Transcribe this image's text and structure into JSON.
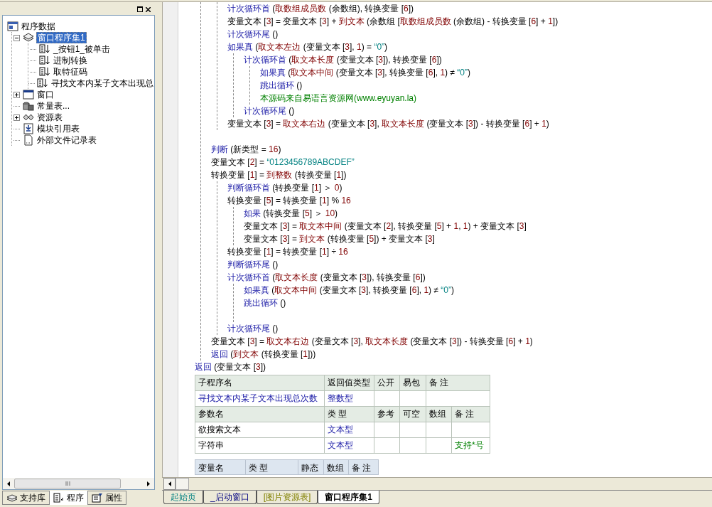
{
  "left_panel": {
    "tree": [
      {
        "kind": "root",
        "label": "程序数据",
        "selected": false,
        "children": [
          {
            "kind": "class",
            "label": "窗口程序集1",
            "selected": true,
            "expanded": true,
            "children": [
              {
                "kind": "method",
                "label": "_按钮1_被单击",
                "selected": false
              },
              {
                "kind": "method",
                "label": "进制转换",
                "selected": false
              },
              {
                "kind": "method",
                "label": "取特征码",
                "selected": false
              },
              {
                "kind": "method",
                "label": "寻找文本内某子文本出现总",
                "selected": false
              }
            ]
          },
          {
            "kind": "window",
            "label": "窗口",
            "selected": false,
            "expanded": false
          },
          {
            "kind": "constants",
            "label": "常量表...",
            "selected": false
          },
          {
            "kind": "resources",
            "label": "资源表",
            "selected": false,
            "expanded": false
          },
          {
            "kind": "modules",
            "label": "模块引用表",
            "selected": false
          },
          {
            "kind": "files",
            "label": "外部文件记录表",
            "selected": false
          }
        ]
      }
    ],
    "tabs": [
      {
        "kind": "library",
        "label": "支持库",
        "selected": false
      },
      {
        "kind": "program",
        "label": "程序",
        "selected": true
      },
      {
        "kind": "properties",
        "label": "属性",
        "selected": false
      }
    ]
  },
  "code": [
    {
      "kind": "group",
      "children": [
        {
          "kind": "group",
          "children": [
            {
              "kind": "line",
              "tokens": [
                {
                  "kind": "kw",
                  "text": "计次循环首"
                },
                {
                  "kind": "txt",
                  "text": " ("
                },
                {
                  "kind": "fn",
                  "text": "取数组成员数"
                },
                {
                  "kind": "txt",
                  "text": " (余数组), 转换变量 ["
                },
                {
                  "kind": "num",
                  "text": "6"
                },
                {
                  "kind": "txt",
                  "text": "])"
                }
              ]
            },
            {
              "kind": "line",
              "tokens": [
                {
                  "kind": "txt",
                  "text": "变量文本 ["
                },
                {
                  "kind": "num",
                  "text": "3"
                },
                {
                  "kind": "txt",
                  "text": "] = 变量文本 ["
                },
                {
                  "kind": "num",
                  "text": "3"
                },
                {
                  "kind": "txt",
                  "text": "] + "
                },
                {
                  "kind": "fn",
                  "text": "到文本"
                },
                {
                  "kind": "txt",
                  "text": " (余数组 ["
                },
                {
                  "kind": "fn",
                  "text": "取数组成员数"
                },
                {
                  "kind": "txt",
                  "text": " (余数组) - 转换变量 ["
                },
                {
                  "kind": "num",
                  "text": "6"
                },
                {
                  "kind": "txt",
                  "text": "] + "
                },
                {
                  "kind": "num",
                  "text": "1"
                },
                {
                  "kind": "txt",
                  "text": "])"
                }
              ]
            },
            {
              "kind": "line",
              "tokens": [
                {
                  "kind": "kw",
                  "text": "计次循环尾"
                },
                {
                  "kind": "txt",
                  "text": " ()"
                }
              ]
            },
            {
              "kind": "line",
              "tokens": [
                {
                  "kind": "kw",
                  "text": "如果真"
                },
                {
                  "kind": "txt",
                  "text": " ("
                },
                {
                  "kind": "fn",
                  "text": "取文本左边"
                },
                {
                  "kind": "txt",
                  "text": " (变量文本 ["
                },
                {
                  "kind": "num",
                  "text": "3"
                },
                {
                  "kind": "txt",
                  "text": "], "
                },
                {
                  "kind": "num",
                  "text": "1"
                },
                {
                  "kind": "txt",
                  "text": ") = "
                },
                {
                  "kind": "str",
                  "text": "“0”"
                },
                {
                  "kind": "txt",
                  "text": ")"
                }
              ],
              "children": [
                {
                  "kind": "line",
                  "tokens": [
                    {
                      "kind": "kw",
                      "text": "计次循环首"
                    },
                    {
                      "kind": "txt",
                      "text": " ("
                    },
                    {
                      "kind": "fn",
                      "text": "取文本长度"
                    },
                    {
                      "kind": "txt",
                      "text": " (变量文本 ["
                    },
                    {
                      "kind": "num",
                      "text": "3"
                    },
                    {
                      "kind": "txt",
                      "text": "]), 转换变量 ["
                    },
                    {
                      "kind": "num",
                      "text": "6"
                    },
                    {
                      "kind": "txt",
                      "text": "])"
                    }
                  ],
                  "children": [
                    {
                      "kind": "line",
                      "tokens": [
                        {
                          "kind": "kw",
                          "text": "如果真"
                        },
                        {
                          "kind": "txt",
                          "text": " ("
                        },
                        {
                          "kind": "fn",
                          "text": "取文本中间"
                        },
                        {
                          "kind": "txt",
                          "text": " (变量文本 ["
                        },
                        {
                          "kind": "num",
                          "text": "3"
                        },
                        {
                          "kind": "txt",
                          "text": "], 转换变量 ["
                        },
                        {
                          "kind": "num",
                          "text": "6"
                        },
                        {
                          "kind": "txt",
                          "text": "], "
                        },
                        {
                          "kind": "num",
                          "text": "1"
                        },
                        {
                          "kind": "txt",
                          "text": ") ≠ "
                        },
                        {
                          "kind": "str",
                          "text": "“0”"
                        },
                        {
                          "kind": "txt",
                          "text": ")"
                        }
                      ]
                    },
                    {
                      "kind": "line",
                      "tokens": [
                        {
                          "kind": "kw",
                          "text": "跳出循环"
                        },
                        {
                          "kind": "txt",
                          "text": " ()"
                        }
                      ]
                    },
                    {
                      "kind": "line",
                      "tokens": [
                        {
                          "kind": "cmt",
                          "text": "本源码来自易语言资源网(www.eyuyan.la)"
                        }
                      ]
                    }
                  ]
                },
                {
                  "kind": "line",
                  "tokens": [
                    {
                      "kind": "kw",
                      "text": "计次循环尾"
                    },
                    {
                      "kind": "txt",
                      "text": " ()"
                    }
                  ]
                }
              ]
            },
            {
              "kind": "line",
              "tokens": [
                {
                  "kind": "txt",
                  "text": "变量文本 ["
                },
                {
                  "kind": "num",
                  "text": "3"
                },
                {
                  "kind": "txt",
                  "text": "] = "
                },
                {
                  "kind": "fn",
                  "text": "取文本右边"
                },
                {
                  "kind": "txt",
                  "text": " (变量文本 ["
                },
                {
                  "kind": "num",
                  "text": "3"
                },
                {
                  "kind": "txt",
                  "text": "], "
                },
                {
                  "kind": "fn",
                  "text": "取文本长度"
                },
                {
                  "kind": "txt",
                  "text": " (变量文本 ["
                },
                {
                  "kind": "num",
                  "text": "3"
                },
                {
                  "kind": "txt",
                  "text": "]) - 转换变量 ["
                },
                {
                  "kind": "num",
                  "text": "6"
                },
                {
                  "kind": "txt",
                  "text": "] + "
                },
                {
                  "kind": "num",
                  "text": "1"
                },
                {
                  "kind": "txt",
                  "text": ")"
                }
              ]
            }
          ]
        },
        {
          "kind": "blank"
        },
        {
          "kind": "line",
          "tokens": [
            {
              "kind": "kw",
              "text": "判断"
            },
            {
              "kind": "txt",
              "text": " (新类型 = "
            },
            {
              "kind": "num",
              "text": "16"
            },
            {
              "kind": "txt",
              "text": ")"
            }
          ]
        },
        {
          "kind": "line",
          "tokens": [
            {
              "kind": "txt",
              "text": "变量文本 ["
            },
            {
              "kind": "num",
              "text": "2"
            },
            {
              "kind": "txt",
              "text": "] = "
            },
            {
              "kind": "str",
              "text": "“0123456789ABCDEF”"
            }
          ]
        },
        {
          "kind": "line",
          "tokens": [
            {
              "kind": "txt",
              "text": "转换变量 ["
            },
            {
              "kind": "num",
              "text": "1"
            },
            {
              "kind": "txt",
              "text": "] = "
            },
            {
              "kind": "fn",
              "text": "到整数"
            },
            {
              "kind": "txt",
              "text": " (转换变量 ["
            },
            {
              "kind": "num",
              "text": "1"
            },
            {
              "kind": "txt",
              "text": "])"
            }
          ]
        },
        {
          "kind": "group",
          "children": [
            {
              "kind": "line",
              "tokens": [
                {
                  "kind": "kw",
                  "text": "判断循环首"
                },
                {
                  "kind": "txt",
                  "text": " (转换变量 ["
                },
                {
                  "kind": "num",
                  "text": "1"
                },
                {
                  "kind": "txt",
                  "text": "] ＞ "
                },
                {
                  "kind": "num",
                  "text": "0"
                },
                {
                  "kind": "txt",
                  "text": ")"
                }
              ]
            },
            {
              "kind": "line",
              "tokens": [
                {
                  "kind": "txt",
                  "text": "转换变量 ["
                },
                {
                  "kind": "num",
                  "text": "5"
                },
                {
                  "kind": "txt",
                  "text": "] = 转换变量 ["
                },
                {
                  "kind": "num",
                  "text": "1"
                },
                {
                  "kind": "txt",
                  "text": "] % "
                },
                {
                  "kind": "num",
                  "text": "16"
                }
              ]
            },
            {
              "kind": "group",
              "children": [
                {
                  "kind": "line",
                  "tokens": [
                    {
                      "kind": "kw",
                      "text": "如果"
                    },
                    {
                      "kind": "txt",
                      "text": " (转换变量 ["
                    },
                    {
                      "kind": "num",
                      "text": "5"
                    },
                    {
                      "kind": "txt",
                      "text": "] ＞ "
                    },
                    {
                      "kind": "num",
                      "text": "10"
                    },
                    {
                      "kind": "txt",
                      "text": ")"
                    }
                  ]
                },
                {
                  "kind": "line",
                  "tokens": [
                    {
                      "kind": "txt",
                      "text": "变量文本 ["
                    },
                    {
                      "kind": "num",
                      "text": "3"
                    },
                    {
                      "kind": "txt",
                      "text": "] = "
                    },
                    {
                      "kind": "fn",
                      "text": "取文本中间"
                    },
                    {
                      "kind": "txt",
                      "text": " (变量文本 ["
                    },
                    {
                      "kind": "num",
                      "text": "2"
                    },
                    {
                      "kind": "txt",
                      "text": "], 转换变量 ["
                    },
                    {
                      "kind": "num",
                      "text": "5"
                    },
                    {
                      "kind": "txt",
                      "text": "] + "
                    },
                    {
                      "kind": "num",
                      "text": "1"
                    },
                    {
                      "kind": "txt",
                      "text": ", "
                    },
                    {
                      "kind": "num",
                      "text": "1"
                    },
                    {
                      "kind": "txt",
                      "text": ") + 变量文本 ["
                    },
                    {
                      "kind": "num",
                      "text": "3"
                    },
                    {
                      "kind": "txt",
                      "text": "]"
                    }
                  ]
                },
                {
                  "kind": "line",
                  "tokens": [
                    {
                      "kind": "txt",
                      "text": "变量文本 ["
                    },
                    {
                      "kind": "num",
                      "text": "3"
                    },
                    {
                      "kind": "txt",
                      "text": "] = "
                    },
                    {
                      "kind": "fn",
                      "text": "到文本"
                    },
                    {
                      "kind": "txt",
                      "text": " (转换变量 ["
                    },
                    {
                      "kind": "num",
                      "text": "5"
                    },
                    {
                      "kind": "txt",
                      "text": "]) + 变量文本 ["
                    },
                    {
                      "kind": "num",
                      "text": "3"
                    },
                    {
                      "kind": "txt",
                      "text": "]"
                    }
                  ]
                }
              ]
            },
            {
              "kind": "line",
              "tokens": [
                {
                  "kind": "txt",
                  "text": "转换变量 ["
                },
                {
                  "kind": "num",
                  "text": "1"
                },
                {
                  "kind": "txt",
                  "text": "] = 转换变量 ["
                },
                {
                  "kind": "num",
                  "text": "1"
                },
                {
                  "kind": "txt",
                  "text": "] ÷ "
                },
                {
                  "kind": "num",
                  "text": "16"
                }
              ]
            },
            {
              "kind": "line",
              "tokens": [
                {
                  "kind": "kw",
                  "text": "判断循环尾"
                },
                {
                  "kind": "txt",
                  "text": " ()"
                }
              ]
            },
            {
              "kind": "line",
              "tokens": [
                {
                  "kind": "kw",
                  "text": "计次循环首"
                },
                {
                  "kind": "txt",
                  "text": " ("
                },
                {
                  "kind": "fn",
                  "text": "取文本长度"
                },
                {
                  "kind": "txt",
                  "text": " (变量文本 ["
                },
                {
                  "kind": "num",
                  "text": "3"
                },
                {
                  "kind": "txt",
                  "text": "]), 转换变量 ["
                },
                {
                  "kind": "num",
                  "text": "6"
                },
                {
                  "kind": "txt",
                  "text": "])"
                }
              ],
              "children": [
                {
                  "kind": "line",
                  "tokens": [
                    {
                      "kind": "kw",
                      "text": "如果真"
                    },
                    {
                      "kind": "txt",
                      "text": " ("
                    },
                    {
                      "kind": "fn",
                      "text": "取文本中间"
                    },
                    {
                      "kind": "txt",
                      "text": " (变量文本 ["
                    },
                    {
                      "kind": "num",
                      "text": "3"
                    },
                    {
                      "kind": "txt",
                      "text": "], 转换变量 ["
                    },
                    {
                      "kind": "num",
                      "text": "6"
                    },
                    {
                      "kind": "txt",
                      "text": "], "
                    },
                    {
                      "kind": "num",
                      "text": "1"
                    },
                    {
                      "kind": "txt",
                      "text": ") ≠ "
                    },
                    {
                      "kind": "str",
                      "text": "“0”"
                    },
                    {
                      "kind": "txt",
                      "text": ")"
                    }
                  ]
                },
                {
                  "kind": "line",
                  "tokens": [
                    {
                      "kind": "kw",
                      "text": "跳出循环"
                    },
                    {
                      "kind": "txt",
                      "text": " ()"
                    }
                  ]
                },
                {
                  "kind": "blank"
                }
              ]
            },
            {
              "kind": "line",
              "tokens": [
                {
                  "kind": "kw",
                  "text": "计次循环尾"
                },
                {
                  "kind": "txt",
                  "text": " ()"
                }
              ]
            }
          ]
        },
        {
          "kind": "line",
          "tokens": [
            {
              "kind": "txt",
              "text": "变量文本 ["
            },
            {
              "kind": "num",
              "text": "3"
            },
            {
              "kind": "txt",
              "text": "] = "
            },
            {
              "kind": "fn",
              "text": "取文本右边"
            },
            {
              "kind": "txt",
              "text": " (变量文本 ["
            },
            {
              "kind": "num",
              "text": "3"
            },
            {
              "kind": "txt",
              "text": "], "
            },
            {
              "kind": "fn",
              "text": "取文本长度"
            },
            {
              "kind": "txt",
              "text": " (变量文本 ["
            },
            {
              "kind": "num",
              "text": "3"
            },
            {
              "kind": "txt",
              "text": "]) - 转换变量 ["
            },
            {
              "kind": "num",
              "text": "6"
            },
            {
              "kind": "txt",
              "text": "] + "
            },
            {
              "kind": "num",
              "text": "1"
            },
            {
              "kind": "txt",
              "text": ")"
            }
          ]
        },
        {
          "kind": "line",
          "tokens": [
            {
              "kind": "kw",
              "text": "返回"
            },
            {
              "kind": "txt",
              "text": " ("
            },
            {
              "kind": "fn",
              "text": "到文本"
            },
            {
              "kind": "txt",
              "text": " (转换变量 ["
            },
            {
              "kind": "num",
              "text": "1"
            },
            {
              "kind": "txt",
              "text": "]))"
            }
          ]
        }
      ]
    },
    {
      "kind": "line",
      "tokens": [
        {
          "kind": "kw",
          "text": "返回"
        },
        {
          "kind": "txt",
          "text": " (变量文本 ["
        },
        {
          "kind": "num",
          "text": "3"
        },
        {
          "kind": "txt",
          "text": "])"
        }
      ]
    }
  ],
  "subroutine_table": {
    "columns": [
      "子程序名",
      "返回值类型",
      "公开",
      "易包",
      "备 注"
    ],
    "row": [
      "寻找文本内某子文本出现总次数",
      "整数型"
    ]
  },
  "params_table": {
    "columns": [
      "参数名",
      "类 型",
      "参考",
      "可空",
      "数组",
      "备 注"
    ],
    "rows": [
      [
        "欲搜索文本",
        "文本型",
        "",
        "",
        "",
        ""
      ],
      [
        "字符串",
        "文本型",
        "",
        "",
        "",
        "支持*号"
      ]
    ]
  },
  "locals_table": {
    "columns": [
      "变量名",
      "类 型",
      "静态",
      "数组",
      "备 注"
    ]
  },
  "editor_tabs": [
    {
      "kind": "start",
      "label": "起始页",
      "selected": false
    },
    {
      "kind": "window",
      "label": "_启动窗口",
      "selected": false
    },
    {
      "kind": "resource",
      "label": "[图片资源表]",
      "selected": false
    },
    {
      "kind": "class",
      "label": "窗口程序集1",
      "selected": true
    }
  ]
}
